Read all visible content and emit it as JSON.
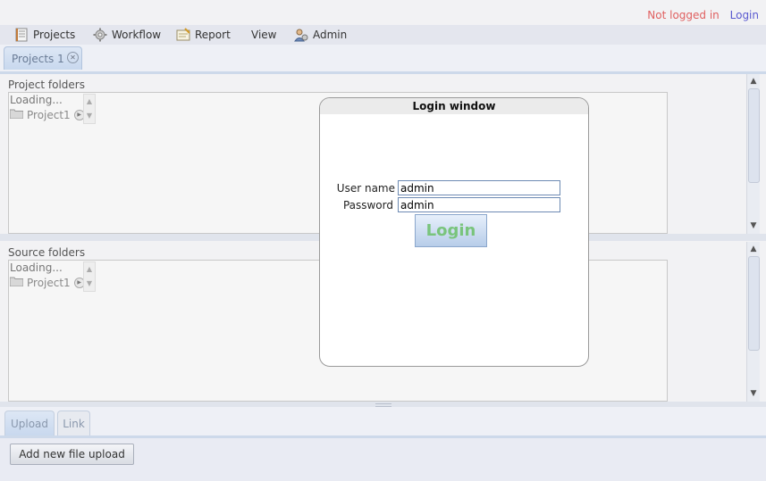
{
  "auth": {
    "status": "Not logged in",
    "login_link": "Login"
  },
  "menu": [
    {
      "label": "Projects",
      "icon": "projects-icon"
    },
    {
      "label": "Workflow",
      "icon": "gear-icon"
    },
    {
      "label": "Report",
      "icon": "report-icon"
    },
    {
      "label": "View",
      "icon": ""
    },
    {
      "label": "Admin",
      "icon": "admin-icon"
    }
  ],
  "tabs": [
    {
      "label": "Projects 1",
      "closable": true
    }
  ],
  "project_folders": {
    "title": "Project folders",
    "loading": "Loading...",
    "node": "Project1"
  },
  "source_folders": {
    "title": "Source folders",
    "loading": "Loading...",
    "node": "Project1"
  },
  "bottom_tabs": [
    {
      "label": "Upload"
    },
    {
      "label": "Link"
    }
  ],
  "upload": {
    "add_button": "Add new file upload"
  },
  "login_window": {
    "title": "Login window",
    "username_label": "User name",
    "username_value": "admin",
    "password_label": "Password",
    "password_value": "admin",
    "login_button": "Login"
  },
  "colors": {
    "not_logged_in": "#e06060",
    "login_link": "#5a5ad0",
    "login_button_text": "#79c47c"
  }
}
